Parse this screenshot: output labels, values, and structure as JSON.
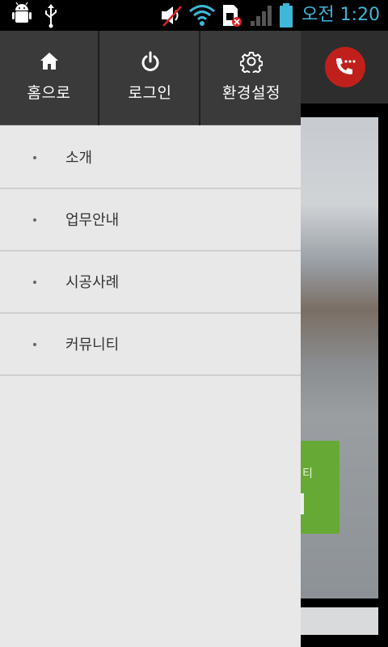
{
  "status_bar": {
    "time": "오전 1:20",
    "icons": [
      "android-debug-icon",
      "usb-icon",
      "volume-muted-icon",
      "wifi-icon",
      "sim-error-icon",
      "signal-icon",
      "battery-icon"
    ]
  },
  "drawer": {
    "top_buttons": [
      {
        "label": "홈으로",
        "icon": "home-icon"
      },
      {
        "label": "로그인",
        "icon": "power-icon"
      },
      {
        "label": "환경설정",
        "icon": "gear-icon"
      }
    ],
    "menu_items": [
      {
        "label": "소개"
      },
      {
        "label": "업무안내"
      },
      {
        "label": "시공사례"
      },
      {
        "label": "커뮤니티"
      }
    ]
  },
  "background_app": {
    "call_icon": "phone-chat-icon",
    "green_banner_text": "티"
  },
  "colors": {
    "drawer_header": "#3a3a3a",
    "drawer_body": "#e8e8e8",
    "time_text": "#3fb7d9",
    "call_button": "#c0201c",
    "banner_green": "#67a935"
  }
}
